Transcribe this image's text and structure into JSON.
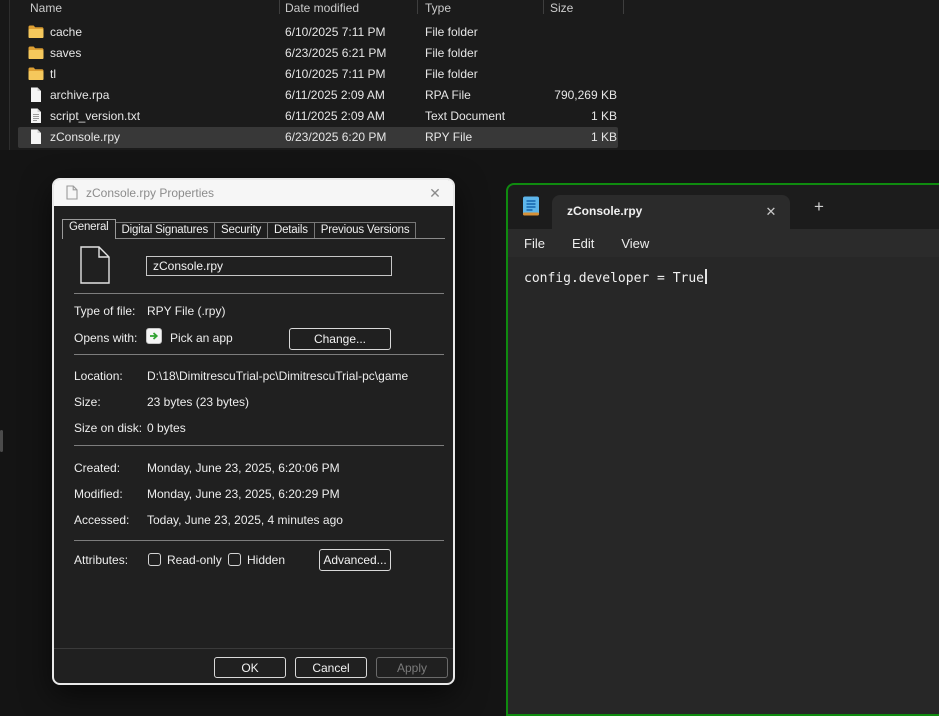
{
  "explorer": {
    "columns": {
      "name": "Name",
      "date": "Date modified",
      "type": "Type",
      "size": "Size"
    },
    "rows": [
      {
        "name": "cache",
        "date": "6/10/2025 7:11 PM",
        "type": "File folder",
        "size": ""
      },
      {
        "name": "saves",
        "date": "6/23/2025 6:21 PM",
        "type": "File folder",
        "size": ""
      },
      {
        "name": "tl",
        "date": "6/10/2025 7:11 PM",
        "type": "File folder",
        "size": ""
      },
      {
        "name": "archive.rpa",
        "date": "6/11/2025 2:09 AM",
        "type": "RPA File",
        "size": "790,269 KB"
      },
      {
        "name": "script_version.txt",
        "date": "6/11/2025 2:09 AM",
        "type": "Text Document",
        "size": "1 KB"
      },
      {
        "name": "zConsole.rpy",
        "date": "6/23/2025 6:20 PM",
        "type": "RPY File",
        "size": "1 KB"
      }
    ],
    "selected_row": "zConsole.rpy"
  },
  "properties_dialog": {
    "title": "zConsole.rpy Properties",
    "close_glyph": "✕",
    "tabs": [
      "General",
      "Digital Signatures",
      "Security",
      "Details",
      "Previous Versions"
    ],
    "active_tab": "General",
    "filename": "zConsole.rpy",
    "fields": {
      "type_label": "Type of file:",
      "type_value": "RPY File (.rpy)",
      "opens_label": "Opens with:",
      "opens_value": "Pick an app",
      "change_button": "Change...",
      "location_label": "Location:",
      "location_value": "D:\\18\\DimitrescuTrial-pc\\DimitrescuTrial-pc\\game",
      "size_label": "Size:",
      "size_value": "23 bytes (23 bytes)",
      "size_on_disk_label": "Size on disk:",
      "size_on_disk_value": "0 bytes",
      "created_label": "Created:",
      "created_value": "Monday, June 23, 2025, 6:20:06 PM",
      "modified_label": "Modified:",
      "modified_value": "Monday, June 23, 2025, 6:20:29 PM",
      "accessed_label": "Accessed:",
      "accessed_value": "Today, June 23, 2025, 4 minutes ago",
      "attributes_label": "Attributes:",
      "readonly_label": "Read-only",
      "hidden_label": "Hidden",
      "advanced_button": "Advanced..."
    },
    "buttons": {
      "ok": "OK",
      "cancel": "Cancel",
      "apply": "Apply"
    }
  },
  "notepad": {
    "tab_title": "zConsole.rpy",
    "close_glyph": "✕",
    "new_tab_glyph": "+",
    "menus": [
      "File",
      "Edit",
      "View"
    ],
    "editor_text": "config.developer = True"
  },
  "colors": {
    "notepad_focus_border": "#0f8b0f",
    "selection_bg": "#383838",
    "folder_yellow": "#f5c85c",
    "explorer_bg": "#1b1b1b",
    "dialog_bg": "#202020"
  }
}
